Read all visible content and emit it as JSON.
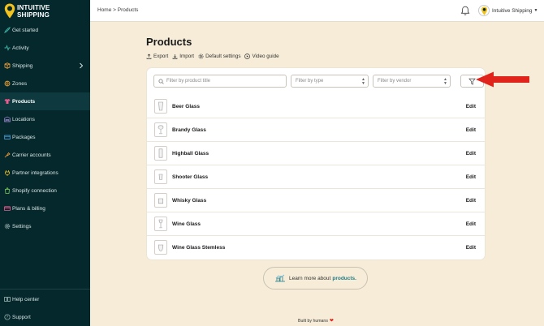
{
  "brand": {
    "name_line1": "INTUITIVE",
    "name_line2": "SHIPPING"
  },
  "sidebar": {
    "items": [
      {
        "label": "Get started",
        "icon": "rocket-icon"
      },
      {
        "label": "Activity",
        "icon": "activity-icon"
      },
      {
        "label": "Shipping",
        "icon": "shipping-icon",
        "expandable": true
      },
      {
        "label": "Zones",
        "icon": "zones-icon"
      },
      {
        "label": "Products",
        "icon": "shirt-icon",
        "active": true
      },
      {
        "label": "Locations",
        "icon": "warehouse-icon"
      },
      {
        "label": "Packages",
        "icon": "package-icon"
      },
      {
        "label": "Carrier accounts",
        "icon": "carrier-icon"
      },
      {
        "label": "Partner integrations",
        "icon": "plug-icon"
      },
      {
        "label": "Shopify connection",
        "icon": "shopify-icon"
      },
      {
        "label": "Plans & billing",
        "icon": "billing-icon"
      },
      {
        "label": "Settings",
        "icon": "gear-icon"
      }
    ],
    "bottom_items": [
      {
        "label": "Help center",
        "icon": "book-icon"
      },
      {
        "label": "Support",
        "icon": "help-icon"
      }
    ]
  },
  "topbar": {
    "breadcrumb": "Home > Products",
    "account_name": "Intuitive Shipping",
    "account_caret": "▼"
  },
  "page": {
    "title": "Products",
    "actions": [
      {
        "label": "Export",
        "icon": "export-icon"
      },
      {
        "label": "Import",
        "icon": "import-icon"
      },
      {
        "label": "Default settings",
        "icon": "gear-icon"
      },
      {
        "label": "Video guide",
        "icon": "play-icon"
      }
    ]
  },
  "filters": {
    "search_placeholder": "Filter by product title",
    "type_placeholder": "Filter by type",
    "vendor_placeholder": "Filter by vendor",
    "select_arrow": "▲\n▼"
  },
  "products": [
    {
      "name": "Beer Glass",
      "action": "Edit"
    },
    {
      "name": "Brandy Glass",
      "action": "Edit"
    },
    {
      "name": "Highball Glass",
      "action": "Edit"
    },
    {
      "name": "Shooter Glass",
      "action": "Edit"
    },
    {
      "name": "Whisky Glass",
      "action": "Edit"
    },
    {
      "name": "Wine Glass",
      "action": "Edit"
    },
    {
      "name": "Wine Glass Stemless",
      "action": "Edit"
    }
  ],
  "learn_more": {
    "prefix": "Learn more about",
    "link": "products."
  },
  "footer": {
    "text": "Built by humans",
    "heart": "❤"
  },
  "colors": {
    "sidebar_bg": "#05282d",
    "page_bg": "#f6ecd8",
    "accent": "#f2c31f",
    "link": "#1d7c86",
    "arrow": "#e0241b"
  }
}
